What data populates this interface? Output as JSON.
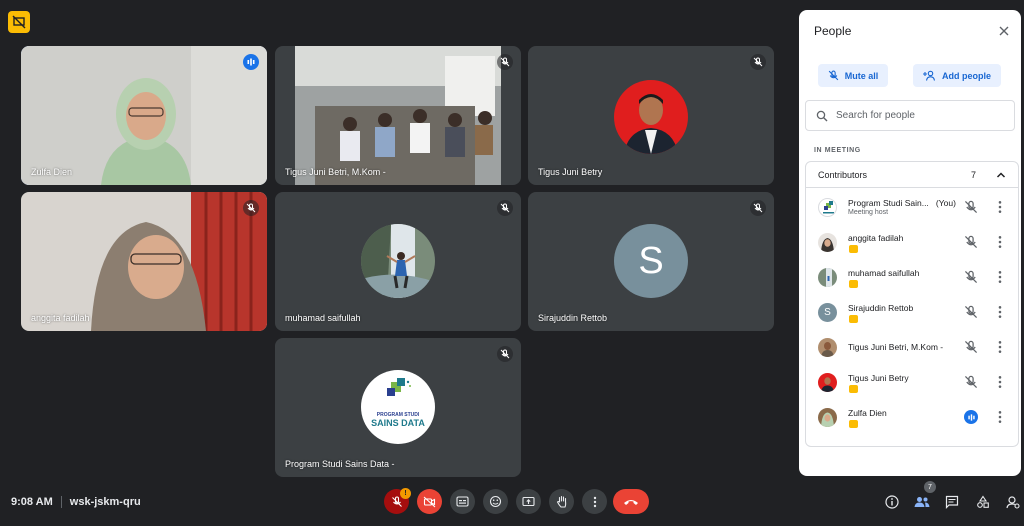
{
  "participants": [
    {
      "name": "Zulfa Dien",
      "state": "speaking"
    },
    {
      "name": "Tigus Juni Betri, M.Kom -",
      "state": "muted"
    },
    {
      "name": "Tigus Juni Betry",
      "state": "muted"
    },
    {
      "name": "anggita fadilah",
      "state": "muted"
    },
    {
      "name": "muhamad saifullah",
      "state": "muted"
    },
    {
      "name": "Sirajuddin Rettob",
      "state": "muted",
      "initial": "S"
    },
    {
      "name": "Program Studi Sains Data -",
      "state": "muted"
    }
  ],
  "logo": {
    "line1": "PROGRAM STUDI",
    "line2": "SAINS DATA"
  },
  "meeting": {
    "time": "9:08 AM",
    "code": "wsk-jskm-qru",
    "people_count": "7",
    "mic_alert": "!"
  },
  "panel": {
    "title": "People",
    "mute_all": "Mute all",
    "add_people": "Add people",
    "search_placeholder": "Search for people",
    "in_meeting": "IN MEETING",
    "contributors_label": "Contributors",
    "contributors_count": "7",
    "rows": [
      {
        "name": "Program Studi Sain...",
        "you": "(You)",
        "sub": "Meeting host"
      },
      {
        "name": "anggita fadilah"
      },
      {
        "name": "muhamad saifullah"
      },
      {
        "name": "Sirajuddin Rettob",
        "initial": "S"
      },
      {
        "name": "Tigus Juni Betri, M.Kom -"
      },
      {
        "name": "Tigus Juni Betry"
      },
      {
        "name": "Zulfa Dien"
      }
    ]
  },
  "colors": {
    "accent": "#1a73e8",
    "end_call": "#ea4335",
    "tile": "#3c4043",
    "background": "#202124",
    "badge": "#fbbc04"
  }
}
